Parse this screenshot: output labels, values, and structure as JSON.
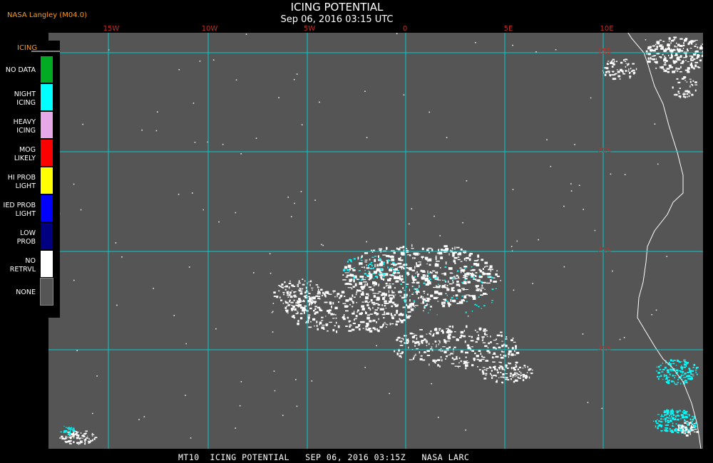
{
  "header": {
    "title": "ICING POTENTIAL",
    "timestamp": "Sep 06, 2016 03:15 UTC",
    "credit": "NASA Langley (M04.0)"
  },
  "legend": {
    "title": "ICING",
    "items": [
      {
        "label": "NO DATA",
        "color": "#00aa22"
      },
      {
        "label": "NIGHT\nICING",
        "color": "#00ffff"
      },
      {
        "label": "HEAVY\nICING",
        "color": "#e6a8e6"
      },
      {
        "label": "MOG\nLIKELY",
        "color": "#ff0000"
      },
      {
        "label": "HI PROB\nLIGHT",
        "color": "#ffff00"
      },
      {
        "label": "IED PROB\nLIGHT",
        "color": "#0000ff"
      },
      {
        "label": "LOW\nPROB",
        "color": "#000080"
      },
      {
        "label": "NO\nRETRVL",
        "color": "#ffffff"
      },
      {
        "label": "NONE",
        "color": "#555555"
      }
    ]
  },
  "map": {
    "background_color": "#555555",
    "grid_color": "#00cccc",
    "coast_color": "#ffffff",
    "longitude_labels": [
      "15W",
      "10W",
      "5W",
      "0",
      "5E",
      "10E"
    ],
    "latitude_labels": [
      "15S",
      "20S",
      "25S",
      "30S"
    ]
  },
  "footer": {
    "text": "MT10  ICING POTENTIAL   SEP 06, 2016 03:15Z   NASA LARC"
  }
}
